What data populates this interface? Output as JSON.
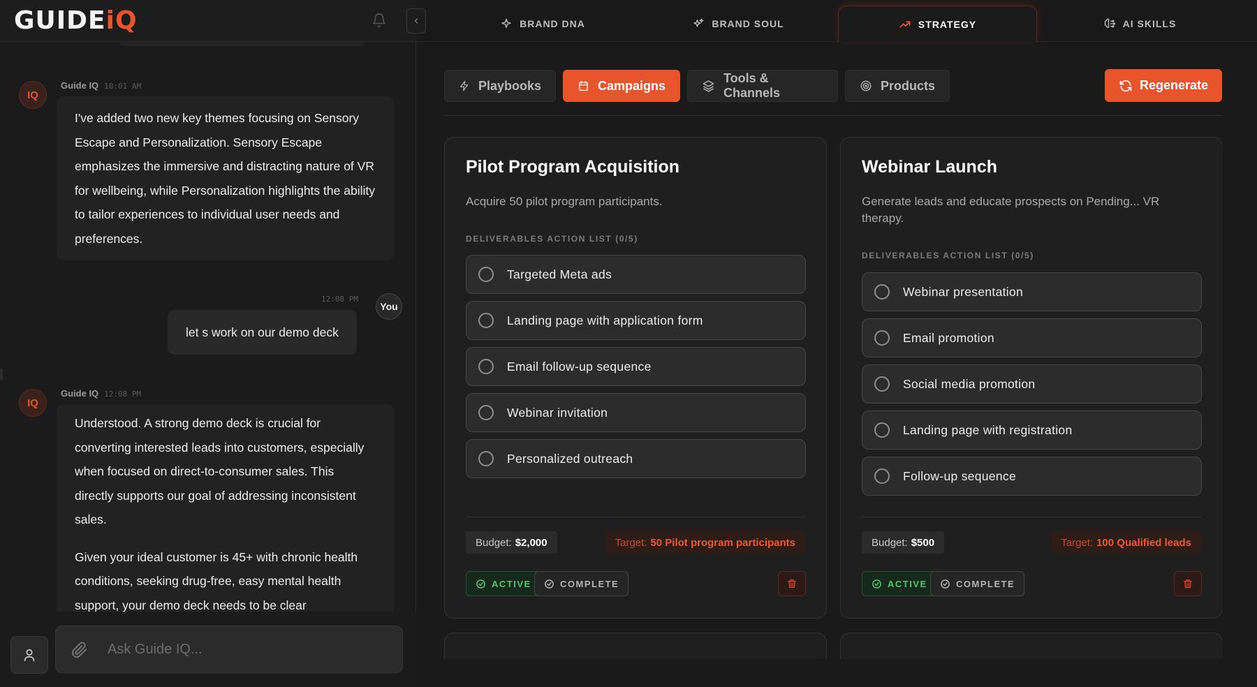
{
  "app": {
    "logo_part1": "GUIDE",
    "logo_part2": "iQ"
  },
  "nav": {
    "tabs": [
      {
        "label": "BRAND DNA",
        "icon": "sparkle-icon"
      },
      {
        "label": "BRAND SOUL",
        "icon": "sparkles-icon"
      },
      {
        "label": "STRATEGY",
        "icon": "trending-up-icon",
        "active": true
      },
      {
        "label": "AI SKILLS",
        "icon": "brain-icon"
      }
    ]
  },
  "subtabs": [
    {
      "label": "Playbooks",
      "icon": "lightning-icon"
    },
    {
      "label": "Campaigns",
      "icon": "calendar-icon",
      "active": true
    },
    {
      "label": "Tools & Channels",
      "icon": "layers-icon"
    },
    {
      "label": "Products",
      "icon": "target-icon"
    }
  ],
  "regenerate_label": "Regenerate",
  "chat": {
    "messages": [
      {
        "author": "Guide IQ",
        "avatar": "IQ",
        "time": "10:01 AM",
        "paragraphs": [
          "I've added two new key themes focusing on Sensory Escape and Personalization. Sensory Escape emphasizes the immersive and distracting nature of VR for wellbeing, while Personalization highlights the ability to tailor experiences to individual user needs and preferences."
        ]
      },
      {
        "author": "You",
        "time": "12:08 PM",
        "text": "let s work on our demo deck"
      },
      {
        "author": "Guide IQ",
        "avatar": "IQ",
        "time": "12:08 PM",
        "paragraphs": [
          "Understood. A strong demo deck is crucial for converting interested leads into customers, especially when focused on direct-to-consumer sales. This directly supports our goal of addressing inconsistent sales.",
          "Given your ideal customer is 45+ with chronic health conditions, seeking drug-free, easy mental health support, your demo deck needs to be clear"
        ]
      }
    ],
    "input_placeholder": "Ask Guide IQ..."
  },
  "campaigns": [
    {
      "title": "Pilot Program Acquisition",
      "description": "Acquire 50 pilot program participants.",
      "deliverables_label": "DELIVERABLES ACTION LIST (0/5)",
      "deliverables": [
        "Targeted Meta ads",
        "Landing page with application form",
        "Email follow-up sequence",
        "Webinar invitation",
        "Personalized outreach"
      ],
      "budget_label": "Budget:",
      "budget_value": "$2,000",
      "target_label": "Target:",
      "target_value": "50 Pilot program participants",
      "active_label": "ACTIVE",
      "complete_label": "COMPLETE"
    },
    {
      "title": "Webinar Launch",
      "description": "Generate leads and educate prospects on Pending... VR therapy.",
      "deliverables_label": "DELIVERABLES ACTION LIST (0/5)",
      "deliverables": [
        "Webinar presentation",
        "Email promotion",
        "Social media promotion",
        "Landing page with registration",
        "Follow-up sequence"
      ],
      "budget_label": "Budget:",
      "budget_value": "$500",
      "target_label": "Target:",
      "target_value": "100 Qualified leads",
      "active_label": "ACTIVE",
      "complete_label": "COMPLETE"
    }
  ],
  "colors": {
    "accent": "#e8542c",
    "background": "#1b1a1a",
    "card": "#201f1f",
    "active_green": "#4fc86a"
  }
}
